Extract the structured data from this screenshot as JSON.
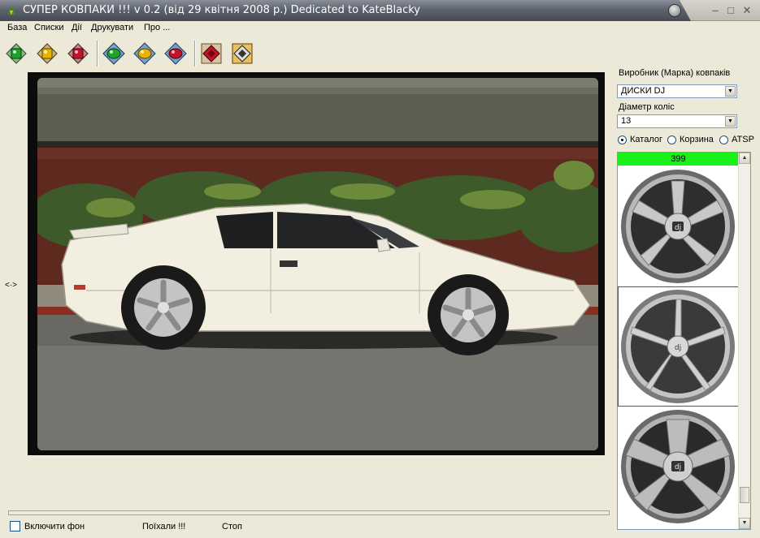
{
  "window": {
    "title": "СУПЕР КОВПАКИ !!! v 0.2 (від 29 квітня 2008 р.) Dedicated to KateBlacky",
    "min_label": "–",
    "max_label": "□",
    "close_label": "✕"
  },
  "menu": {
    "items": [
      "База",
      "Списки",
      "Дії",
      "Друкувати",
      "Про ..."
    ]
  },
  "toolbar": {
    "buttons": [
      {
        "icon": "green-gem-icon",
        "color": "#1fa22a"
      },
      {
        "icon": "yellow-gem-icon",
        "color": "#e8b400"
      },
      {
        "icon": "red-gem-icon",
        "color": "#c0142a"
      },
      {
        "icon": "green-pill-icon",
        "color": "#1fa22a"
      },
      {
        "icon": "yellow-pill-icon",
        "color": "#e8b400"
      },
      {
        "icon": "red-pill-icon",
        "color": "#c0142a"
      },
      {
        "icon": "red-heart-icon",
        "color": "#c0142a"
      },
      {
        "icon": "dark-diamond-icon",
        "color": "#333333"
      }
    ]
  },
  "viewer": {
    "nav_label": "<·>"
  },
  "panel": {
    "manufacturer_label": "Виробник (Марка) ковпаків",
    "manufacturer_value": "ДИСКИ DJ",
    "diameter_label": "Діаметр коліс",
    "diameter_value": "13",
    "radios": [
      {
        "label": "Каталог",
        "checked": true
      },
      {
        "label": "Корзина",
        "checked": false
      },
      {
        "label": "ATSP",
        "checked": false
      }
    ],
    "count": "399"
  },
  "bottom": {
    "background_toggle": "Включити фон",
    "go_label": "Поїхали !!!",
    "stop_label": "Стоп"
  },
  "colors": {
    "title_bar": "#4f5560",
    "count_bar": "#19ef19",
    "car": "#f2efe1"
  }
}
